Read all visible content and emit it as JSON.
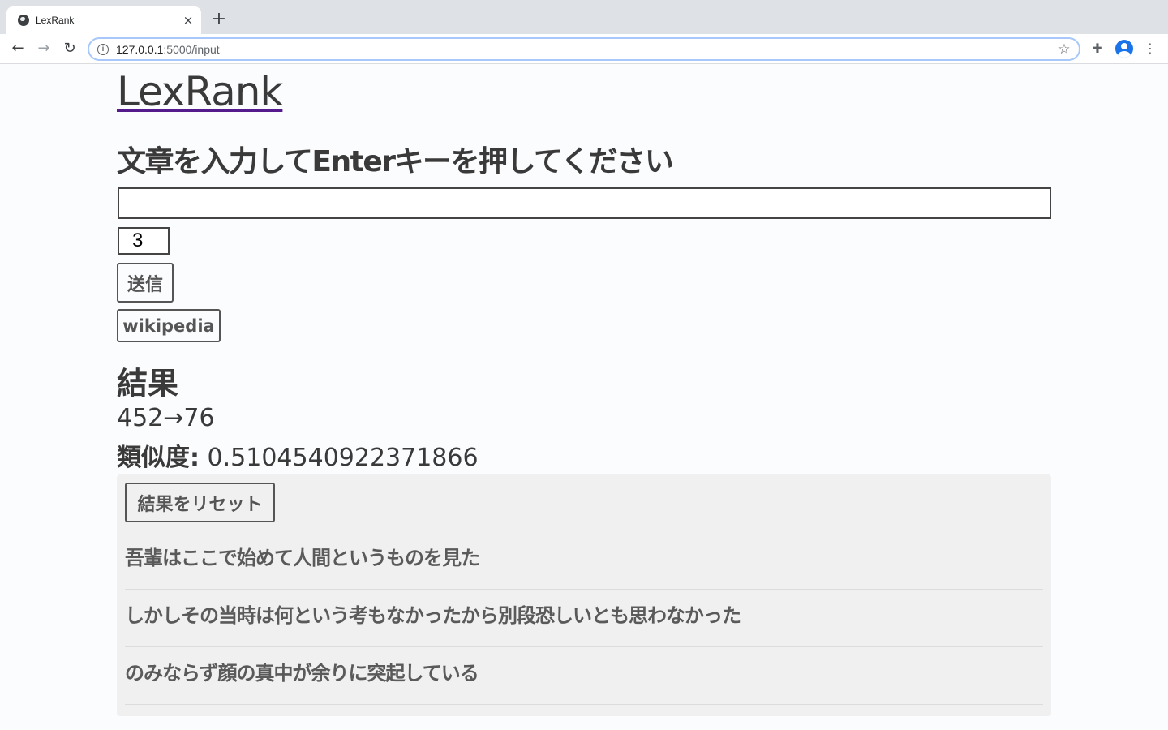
{
  "browser": {
    "tab_title": "LexRank",
    "tab_close": "×",
    "new_tab": "+",
    "url_host": "127.0.0.1",
    "url_path": ":5000/input",
    "icons": {
      "favicon": "globe-icon",
      "back": "arrow-left-icon",
      "forward": "arrow-right-icon",
      "reload": "reload-icon",
      "info": "info-icon",
      "bookmark": "star-icon",
      "extensions": "puzzle-icon",
      "profile": "profile-icon",
      "menu": "kebab-menu-icon"
    }
  },
  "page": {
    "site_title": "LexRank",
    "prompt": "文章を入力してEnterキーを押してください",
    "text_input_value": "",
    "num_sentences": "3",
    "submit_label": "送信",
    "wiki_label": "wikipedia",
    "result_heading": "結果",
    "counts": "452→76",
    "similarity_label": "類似度:",
    "similarity_value": "0.5104540922371866",
    "reset_label": "結果をリセット",
    "sentences": [
      "吾輩はここで始めて人間というものを見た",
      "しかしその当時は何という考もなかったから別段恐しいとも思わなかった",
      "のみならず顔の真中が余りに突起している"
    ]
  },
  "colors": {
    "link_underline": "#551a8b",
    "text": "#3a3a3a",
    "panel_bg": "#f0f0f0",
    "omnibox_focus": "#a8c7fa"
  }
}
